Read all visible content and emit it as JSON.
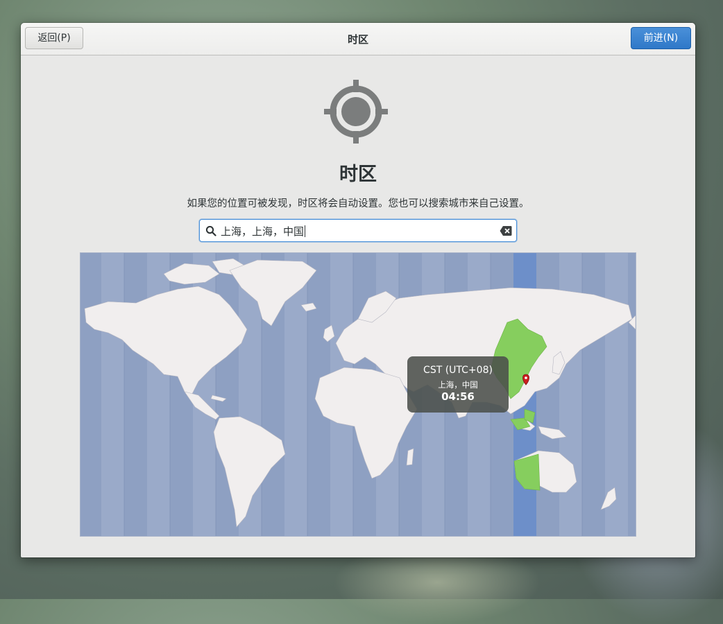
{
  "window": {
    "title": "时区",
    "back_label": "返回(P)",
    "next_label": "前进(N)"
  },
  "main": {
    "title": "时区",
    "description": "如果您的位置可被发现，时区将会自动设置。您也可以搜索城市来自己设置。"
  },
  "search": {
    "value": "上海，上海，中国",
    "icons": [
      "search-icon",
      "clear-icon"
    ]
  },
  "map": {
    "selected_timezone": "CST (UTC+08)",
    "location": "上海，中国",
    "time": "04:56",
    "colors": {
      "ocean": "#8ea0c2",
      "highlight_band": "#6d8fc9",
      "land": "#f1eeee",
      "selected_zone": "#86ce5e",
      "pin": "#cc1f1f"
    }
  },
  "colors": {
    "accent": "#3584e4",
    "window_bg": "#e8e8e7"
  }
}
